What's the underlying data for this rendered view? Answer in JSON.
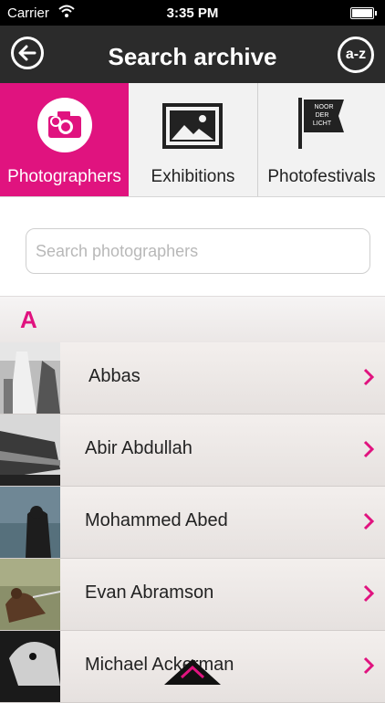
{
  "status_bar": {
    "carrier": "Carrier",
    "time": "3:35 PM"
  },
  "header": {
    "title": "Search archive",
    "az_label": "a-z",
    "bg_color": "#2b2b2b"
  },
  "tabs": [
    {
      "label": "Photographers",
      "icon": "camera-icon",
      "active": true
    },
    {
      "label": "Exhibitions",
      "icon": "picture-frame-icon",
      "active": false
    },
    {
      "label": "Photofestivals",
      "icon": "noorderlicht-flag-icon",
      "active": false
    }
  ],
  "tab_flag_text": [
    "NOOR",
    "DER",
    "LICHT"
  ],
  "accent_color": "#e0137f",
  "search": {
    "placeholder": "Search photographers",
    "value": ""
  },
  "section": {
    "letter": "A"
  },
  "photographers": [
    {
      "name": "Abbas"
    },
    {
      "name": "Abir  Abdullah"
    },
    {
      "name": "Mohammed Abed"
    },
    {
      "name": "Evan Abramson"
    },
    {
      "name": "Michael Ackerman"
    }
  ]
}
